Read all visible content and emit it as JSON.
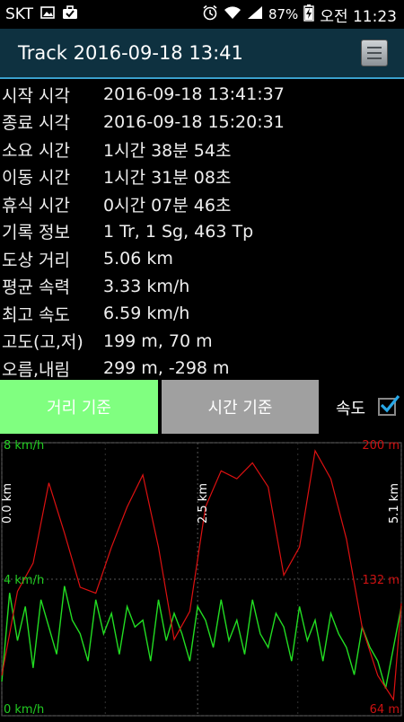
{
  "status": {
    "carrier": "SKT",
    "battery": "87%",
    "time": "오전 11:23"
  },
  "title": "Track 2016-09-18 13:41",
  "info_rows": [
    {
      "label": "시작 시각",
      "value": "2016-09-18 13:41:37"
    },
    {
      "label": "종료 시각",
      "value": "2016-09-18 15:20:31"
    },
    {
      "label": "소요 시간",
      "value": "1시간 38분 54초"
    },
    {
      "label": "이동 시간",
      "value": "1시간 31분 08초"
    },
    {
      "label": "휴식 시간",
      "value": "0시간 07분 46초"
    },
    {
      "label": "기록 정보",
      "value": "1 Tr, 1 Sg, 463 Tp"
    },
    {
      "label": "도상 거리",
      "value": "5.06 km"
    },
    {
      "label": "평균 속력",
      "value": "3.33 km/h"
    },
    {
      "label": "최고 속도",
      "value": "6.59 km/h"
    },
    {
      "label": "고도(고,저)",
      "value": "199 m, 70 m"
    },
    {
      "label": "오름,내림",
      "value": "299 m, -298 m"
    }
  ],
  "buttons": {
    "distance": "거리 기준",
    "time": "시간 기준",
    "speed_label": "속도",
    "speed_checked": true
  },
  "chart_data": {
    "type": "line",
    "x_axis_labels": [
      "0.0 km",
      "2.5 km",
      "5.1 km"
    ],
    "x_range": [
      0,
      5.1
    ],
    "speed_axis_labels": [
      "8 km/h",
      "4 km/h",
      "0 km/h"
    ],
    "speed_range": [
      0,
      8
    ],
    "altitude_axis_labels": [
      "200 m",
      "132 m",
      "64 m"
    ],
    "altitude_range": [
      64,
      200
    ],
    "grid": true,
    "colors": {
      "speed": "#22dd22",
      "altitude": "#dd1111",
      "speed_label": "#22cc22",
      "altitude_label": "#cc1111"
    },
    "series": [
      {
        "type": "altitude",
        "x": [
          0.0,
          0.2,
          0.4,
          0.6,
          0.8,
          1.0,
          1.2,
          1.4,
          1.6,
          1.8,
          2.0,
          2.2,
          2.4,
          2.6,
          2.8,
          3.0,
          3.2,
          3.4,
          3.6,
          3.8,
          4.0,
          4.2,
          4.4,
          4.6,
          4.8,
          5.0,
          5.1
        ],
        "values": [
          84,
          126,
          140,
          180,
          155,
          128,
          125,
          148,
          168,
          184,
          148,
          102,
          116,
          168,
          186,
          182,
          190,
          178,
          134,
          148,
          196,
          182,
          152,
          108,
          84,
          72,
          120
        ]
      },
      {
        "type": "speed",
        "x": [
          0.0,
          0.1,
          0.2,
          0.3,
          0.4,
          0.5,
          0.6,
          0.7,
          0.8,
          0.9,
          1.0,
          1.1,
          1.2,
          1.3,
          1.4,
          1.5,
          1.6,
          1.7,
          1.8,
          1.9,
          2.0,
          2.1,
          2.2,
          2.3,
          2.4,
          2.5,
          2.6,
          2.7,
          2.8,
          2.9,
          3.0,
          3.1,
          3.2,
          3.3,
          3.4,
          3.5,
          3.6,
          3.7,
          3.8,
          3.9,
          4.0,
          4.1,
          4.2,
          4.3,
          4.4,
          4.5,
          4.6,
          4.7,
          4.8,
          4.9,
          5.0,
          5.1
        ],
        "values": [
          1,
          3.6,
          2.2,
          3.2,
          1.4,
          3.4,
          2.6,
          1.8,
          3.8,
          2.8,
          2.4,
          1.6,
          3.4,
          2.4,
          3.0,
          1.8,
          3.2,
          2.6,
          2.8,
          1.6,
          3.4,
          2.2,
          3.0,
          2.4,
          1.6,
          3.2,
          2.8,
          2.0,
          3.4,
          2.2,
          2.8,
          1.8,
          3.4,
          2.4,
          2.0,
          3.0,
          2.6,
          1.6,
          3.2,
          2.2,
          2.8,
          1.6,
          3.0,
          2.4,
          2.0,
          1.2,
          2.6,
          2.0,
          1.6,
          0.8,
          2.0,
          3.2
        ]
      }
    ]
  }
}
